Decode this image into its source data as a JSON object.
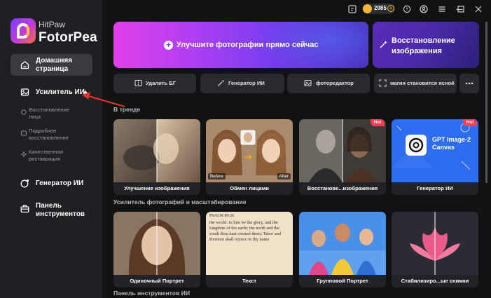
{
  "brand": {
    "small": "HitPaw",
    "name": "FotorPea"
  },
  "sidebar": {
    "home": {
      "line1": "Домашняя",
      "line2": "страница"
    },
    "ai_enhancer": "Усилитель ИИ",
    "sub_items": [
      {
        "line1": "Восстановление",
        "line2": "лица"
      },
      {
        "line1": "Подробное",
        "line2": "восстановление"
      },
      {
        "line1": "Качественная",
        "line2": "реставрация"
      }
    ],
    "ai_generator": "Генератор ИИ",
    "toolbar": {
      "line1": "Панель",
      "line2": "инструментов"
    }
  },
  "topbar": {
    "coins": "2985",
    "coin_plus": "+"
  },
  "hero": {
    "plus": "+",
    "text": "Улучшите фотографии прямо сейчас"
  },
  "restore": {
    "text": "Восстановление изображения"
  },
  "tools": [
    {
      "label": "Удалить БГ",
      "icon": "remove-bg-icon"
    },
    {
      "label": "Генератор ИИ",
      "icon": "magic-wand-icon"
    },
    {
      "label": "фоторедактор",
      "icon": "photo-edit-icon"
    },
    {
      "label": "магия становится ясной",
      "icon": "frame-icon"
    }
  ],
  "sections": {
    "trending": "В тренде",
    "enhance": "Усилитель фотографий и масштабирование",
    "toolpanel": "Панель инструментов ИИ"
  },
  "trending_cards": [
    {
      "label": "Улучшение изображения",
      "hot": ""
    },
    {
      "label": "Обмен лицами",
      "hot": "",
      "tag_before": "Before",
      "tag_after": "After"
    },
    {
      "label": "Восстанове...изображения",
      "hot": "Hot"
    },
    {
      "label": "Генератор ИИ",
      "hot": "Hot",
      "promo": "GPT Image-2 Canvas"
    }
  ],
  "enhance_cards": [
    {
      "label": "Одиночный Портрет"
    },
    {
      "label": "Текст",
      "psalm": "PSALM 89:26",
      "psalm_text": "the world: to him be the glory, and the kingdom of the earth; the north and the south thou hast created them; Tabor and Hermon shall rejoice in thy name"
    },
    {
      "label": "Групповой Портрет"
    },
    {
      "label": "Стабилизиро...ые снимки"
    }
  ],
  "colors": {
    "accent": "#7a3df0",
    "hot": "#ff3b55",
    "coin": "#f4b63a",
    "sidebar": "#1f2024",
    "bg": "#111214"
  }
}
